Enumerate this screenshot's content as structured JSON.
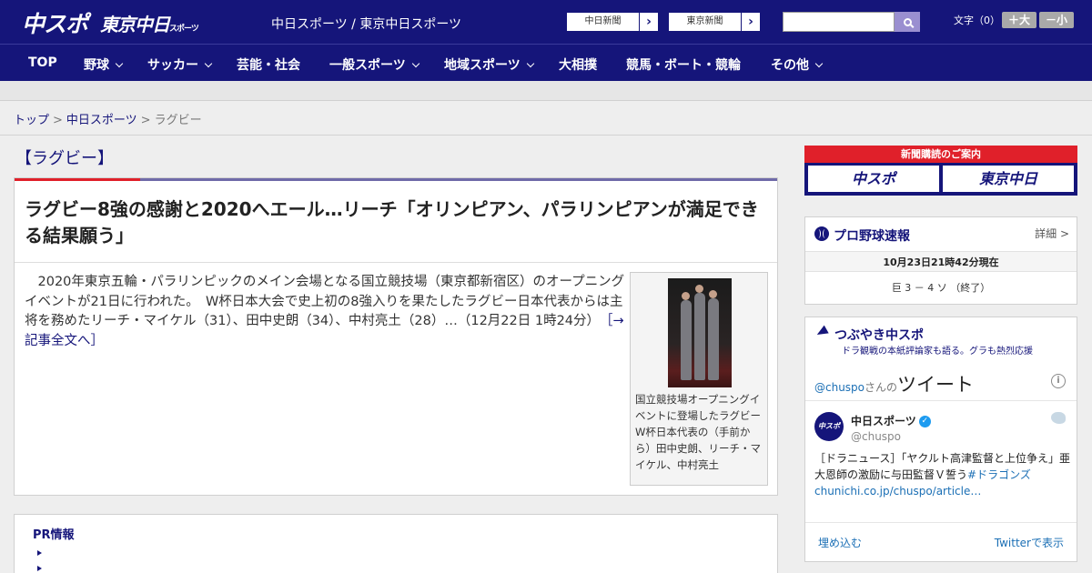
{
  "header": {
    "logo_main": "中スポ",
    "logo_tokyo": "東京中日",
    "logo_tokyo_small": "スポーツ",
    "site_title": "中日スポーツ / 東京中日スポーツ",
    "paper_buttons": [
      {
        "label": "中日新聞",
        "arrow": "›"
      },
      {
        "label": "東京新聞",
        "arrow": "›"
      }
    ],
    "search_placeholder": "",
    "font_label": "文字（0）",
    "font_bigger": "＋大",
    "font_smaller": "－小"
  },
  "nav": {
    "items": [
      {
        "label": "TOP",
        "has_dropdown": false
      },
      {
        "label": "野球",
        "has_dropdown": true
      },
      {
        "label": "サッカー",
        "has_dropdown": true
      },
      {
        "label": "芸能・社会",
        "has_dropdown": false
      },
      {
        "label": "一般スポーツ",
        "has_dropdown": true
      },
      {
        "label": "地域スポーツ",
        "has_dropdown": true
      },
      {
        "label": "大相撲",
        "has_dropdown": false
      },
      {
        "label": "競馬・ボート・競輪",
        "has_dropdown": false
      },
      {
        "label": "その他",
        "has_dropdown": true
      }
    ]
  },
  "breadcrumb": {
    "items": [
      "トップ",
      "中日スポーツ",
      "ラグビー"
    ],
    "separator": ">"
  },
  "section_title": "【ラグビー】",
  "article": {
    "title": "ラグビー8強の感謝と2020へエール…リーチ「オリンピアン、パラリンピアンが満足できる結果願う」",
    "body": "　2020年東京五輪・パラリンピックのメイン会場となる国立競技場（東京都新宿区）のオープニングイベントが21日に行われた。　W杯日本大会で史上初の8強入りを果たしたラグビー日本代表からは主将を務めたリーチ・マイケル（31）、田中史朗（34）、中村亮土（28）…（12月22日 1時24分）",
    "more_link": "［→記事全文へ］",
    "photo_caption": "国立競技場オープニングイベントに登場したラグビーW杯日本代表の（手前から）田中史朗、リーチ・マイケル、中村亮土"
  },
  "pr": {
    "title": "PR情報"
  },
  "sidebar": {
    "subscription": {
      "top": "新聞購読のご案内",
      "left": "中スポ",
      "right": "東京中日"
    },
    "baseball": {
      "heading": "プロ野球速報",
      "detail": "詳細 >",
      "time": "10月23日21時42分現在",
      "score": "巨 3 － 4 ソ （終了）"
    },
    "tweets": {
      "heading": "つぶやき中スポ",
      "sub": "ドラ観戦の本紙評論家も語る。グラも熱烈応援",
      "handle_link": "@chuspo",
      "handle_suffix": "さんの",
      "tweet_word": "ツイート",
      "avatar_text": "中スポ",
      "name": "中日スポーツ",
      "user": "@chuspo",
      "text": "［ドラニュース］「ヤクルト高津監督と上位争え」亜大恩師の激励に与田監督Ｖ誓う",
      "hashtag": "#ドラゴンズ",
      "link": "chunichi.co.jp/chuspo/article…",
      "embed": "埋め込む",
      "view_on_twitter": "Twitterで表示"
    }
  }
}
